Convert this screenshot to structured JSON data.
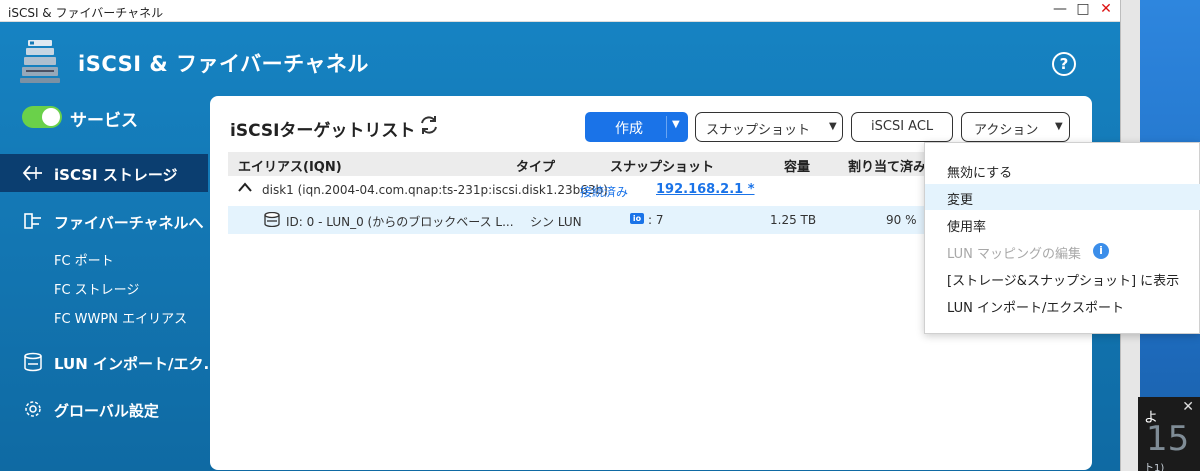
{
  "window": {
    "title": "iSCSI & ファイバーチャネル",
    "controls": {
      "minimize": "—",
      "maximize": "□",
      "close": "✕"
    }
  },
  "app": {
    "title": "iSCSI & ファイバーチャネル",
    "help": "?"
  },
  "sidebar": {
    "service_label": "サービス",
    "service_on": true,
    "items": [
      {
        "label": "iSCSI ストレージ",
        "icon": "iscsi-storage-icon",
        "active": true
      },
      {
        "label": "ファイバーチャネルへ",
        "icon": "fibre-channel-icon",
        "active": false
      },
      {
        "label": "LUN インポート/エク...",
        "icon": "lun-import-icon",
        "active": false
      },
      {
        "label": "グローバル設定",
        "icon": "gear-icon",
        "active": false
      }
    ],
    "sub_items": [
      "FC ポート",
      "FC ストレージ",
      "FC WWPN エイリアス"
    ]
  },
  "panel": {
    "title": "iSCSIターゲットリスト",
    "buttons": {
      "create": "作成",
      "snapshot": "スナップショット",
      "acl": "iSCSI ACL",
      "action": "アクション"
    },
    "columns": [
      "エイリアス(IQN)",
      "タイプ",
      "スナップショット",
      "容量",
      "割り当て済み"
    ],
    "target": {
      "name": "disk1 (iqn.2004-04.com.qnap:ts-231p:iscsi.disk1.23b63b)",
      "status": "接続済み",
      "ip": "192.168.2.1 *"
    },
    "lun": {
      "name": "ID: 0 - LUN_0 (からのブロックベース L...",
      "type": "シン LUN",
      "snapshot_badge": "io",
      "snapshot_count": ": 7",
      "capacity": "1.25 TB",
      "allocated": "90 %"
    }
  },
  "menu": {
    "items": [
      {
        "label": "無効にする",
        "state": "normal"
      },
      {
        "label": "変更",
        "state": "hover"
      },
      {
        "label": "使用率",
        "state": "normal"
      },
      {
        "label": "LUN マッピングの編集",
        "state": "disabled"
      },
      {
        "label": "[ストレージ&スナップショット] に表示",
        "state": "normal"
      },
      {
        "label": "LUN インポート/エクスポート",
        "state": "normal"
      }
    ],
    "info": "i"
  },
  "desktop": {
    "notif_line1": "よ",
    "notif_line2": "15",
    "notif_line3": "ト1)",
    "notif_close": "✕"
  },
  "colors": {
    "accent": "#1a73e8",
    "app_bg": "#1479b6",
    "sidebar_active": "#0b3e70",
    "toggle_on": "#6ad14a",
    "row_highlight": "#e4f3fd"
  }
}
